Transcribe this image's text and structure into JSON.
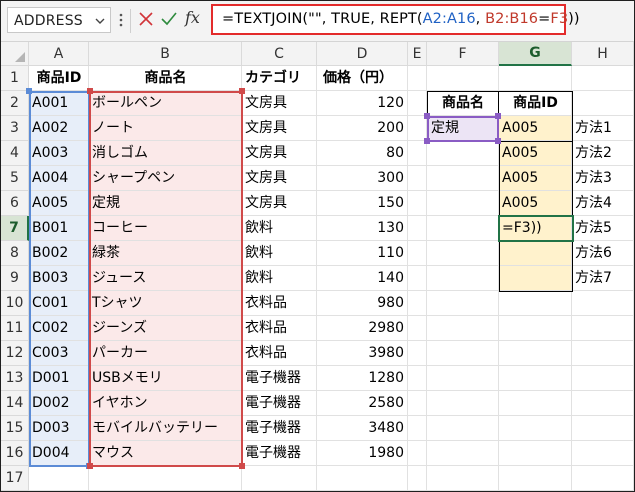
{
  "formula_bar": {
    "name_box": "ADDRESS",
    "formula": {
      "prefix": "=TEXTJOIN(\"\", TRUE, REPT(",
      "ref1": "A2:A16",
      "comma": ", ",
      "ref2": "B2:B16",
      "eq": "=",
      "ref3": "F3",
      "suffix": "))"
    }
  },
  "columns": [
    "A",
    "B",
    "C",
    "D",
    "E",
    "F",
    "G",
    "H"
  ],
  "rows": [
    "1",
    "2",
    "3",
    "4",
    "5",
    "6",
    "7",
    "8",
    "9",
    "10",
    "11",
    "12",
    "13",
    "14",
    "15",
    "16",
    "17"
  ],
  "selected_column": "G",
  "selected_row": "7",
  "headers": {
    "id": "商品ID",
    "name": "商品名",
    "category": "カテゴリ",
    "price": "価格（円）"
  },
  "products": [
    {
      "id": "A001",
      "name": "ボールペン",
      "category": "文房具",
      "price": "120"
    },
    {
      "id": "A002",
      "name": "ノート",
      "category": "文房具",
      "price": "200"
    },
    {
      "id": "A003",
      "name": "消しゴム",
      "category": "文房具",
      "price": "80"
    },
    {
      "id": "A004",
      "name": "シャープペン",
      "category": "文房具",
      "price": "300"
    },
    {
      "id": "A005",
      "name": "定規",
      "category": "文房具",
      "price": "150"
    },
    {
      "id": "B001",
      "name": "コーヒー",
      "category": "飲料",
      "price": "130"
    },
    {
      "id": "B002",
      "name": "緑茶",
      "category": "飲料",
      "price": "110"
    },
    {
      "id": "B003",
      "name": "ジュース",
      "category": "飲料",
      "price": "140"
    },
    {
      "id": "C001",
      "name": "Tシャツ",
      "category": "衣料品",
      "price": "980"
    },
    {
      "id": "C002",
      "name": "ジーンズ",
      "category": "衣料品",
      "price": "2980"
    },
    {
      "id": "C003",
      "name": "パーカー",
      "category": "衣料品",
      "price": "3980"
    },
    {
      "id": "D001",
      "name": "USBメモリ",
      "category": "電子機器",
      "price": "1280"
    },
    {
      "id": "D002",
      "name": "イヤホン",
      "category": "電子機器",
      "price": "2580"
    },
    {
      "id": "D003",
      "name": "モバイルバッテリー",
      "category": "電子機器",
      "price": "3480"
    },
    {
      "id": "D004",
      "name": "マウス",
      "category": "電子機器",
      "price": "1980"
    }
  ],
  "lookup": {
    "header_name": "商品名",
    "header_id": "商品ID",
    "query": "定規",
    "results": [
      "A005",
      "A005",
      "A005",
      "A005",
      "=F3))",
      "",
      ""
    ],
    "methods": [
      "方法1",
      "方法2",
      "方法3",
      "方法4",
      "方法5",
      "方法6",
      "方法7"
    ]
  },
  "colors": {
    "formula_highlight": "#e32b2b",
    "ref_blue": "#1f61c4",
    "ref_red": "#c0392b",
    "active_cell": "#217346",
    "result_fill": "#fff2cc"
  }
}
